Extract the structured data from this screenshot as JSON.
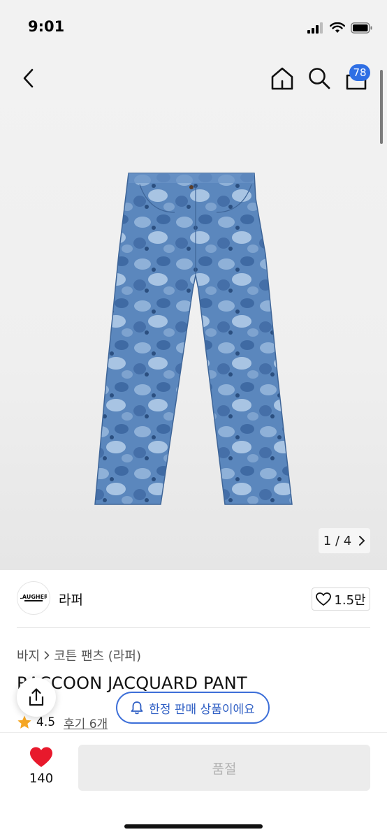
{
  "status_bar": {
    "time": "9:01"
  },
  "header": {
    "cart_count": "78"
  },
  "gallery": {
    "page_indicator": "1 / 4"
  },
  "brand": {
    "logo_text": "LAUGHER",
    "name": "라퍼",
    "likes": "1.5만"
  },
  "breadcrumb": {
    "category": "바지",
    "subcategory": "코튼 팬츠 (라퍼)"
  },
  "product": {
    "title": "RACCOON JACQUARD PANT"
  },
  "rating": {
    "score": "4.5",
    "reviews_label": "후기 6개"
  },
  "notice": {
    "label": "한정 판매 상품이에요"
  },
  "bottom": {
    "wish_count": "140",
    "buy_label": "품절"
  },
  "colors": {
    "accent": "#2f6fe4",
    "heart": "#e8192c",
    "star": "#f5a623",
    "denim": "#5b87bd"
  }
}
